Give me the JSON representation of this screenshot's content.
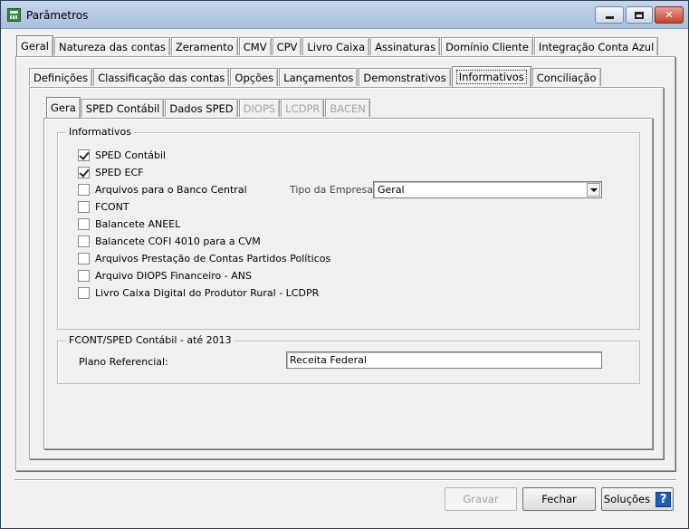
{
  "window": {
    "title": "Parâmetros"
  },
  "main_tabs": [
    "Geral",
    "Natureza das contas",
    "Zeramento",
    "CMV",
    "CPV",
    "Livro Caixa",
    "Assinaturas",
    "Domínio Cliente",
    "Integração Conta Azul"
  ],
  "sub_tabs": [
    "Definições",
    "Classificação das contas",
    "Opções",
    "Lançamentos",
    "Demonstrativos",
    "Informativos",
    "Conciliação"
  ],
  "inner_tabs": [
    {
      "label": "Gera",
      "disabled": false
    },
    {
      "label": "SPED Contábil",
      "disabled": false
    },
    {
      "label": "Dados SPED",
      "disabled": false
    },
    {
      "label": "DIOPS",
      "disabled": true
    },
    {
      "label": "LCDPR",
      "disabled": true
    },
    {
      "label": "BACEN",
      "disabled": true
    }
  ],
  "informativos": {
    "label": "Informativos",
    "options": [
      {
        "label": "SPED Contábil",
        "checked": true
      },
      {
        "label": "SPED ECF",
        "checked": true
      },
      {
        "label": "Arquivos para o Banco Central",
        "checked": false
      },
      {
        "label": "FCONT",
        "checked": false
      },
      {
        "label": "Balancete ANEEL",
        "checked": false
      },
      {
        "label": "Balancete COFI 4010 para a CVM",
        "checked": false
      },
      {
        "label": "Arquivos Prestação de Contas Partidos Políticos",
        "checked": false
      },
      {
        "label": "Arquivo DIOPS Financeiro - ANS",
        "checked": false
      },
      {
        "label": "Livro Caixa Digital do Produtor Rural - LCDPR",
        "checked": false
      }
    ],
    "tipo_empresa_label": "Tipo da Empresa:",
    "tipo_empresa_value": "Geral"
  },
  "fcont": {
    "label": "FCONT/SPED Contábil - até 2013",
    "plano_label": "Plano Referencial:",
    "plano_value": "Receita Federal"
  },
  "buttons": {
    "gravar": "Gravar",
    "fechar": "Fechar",
    "solucoes": "Soluções",
    "help": "?"
  }
}
